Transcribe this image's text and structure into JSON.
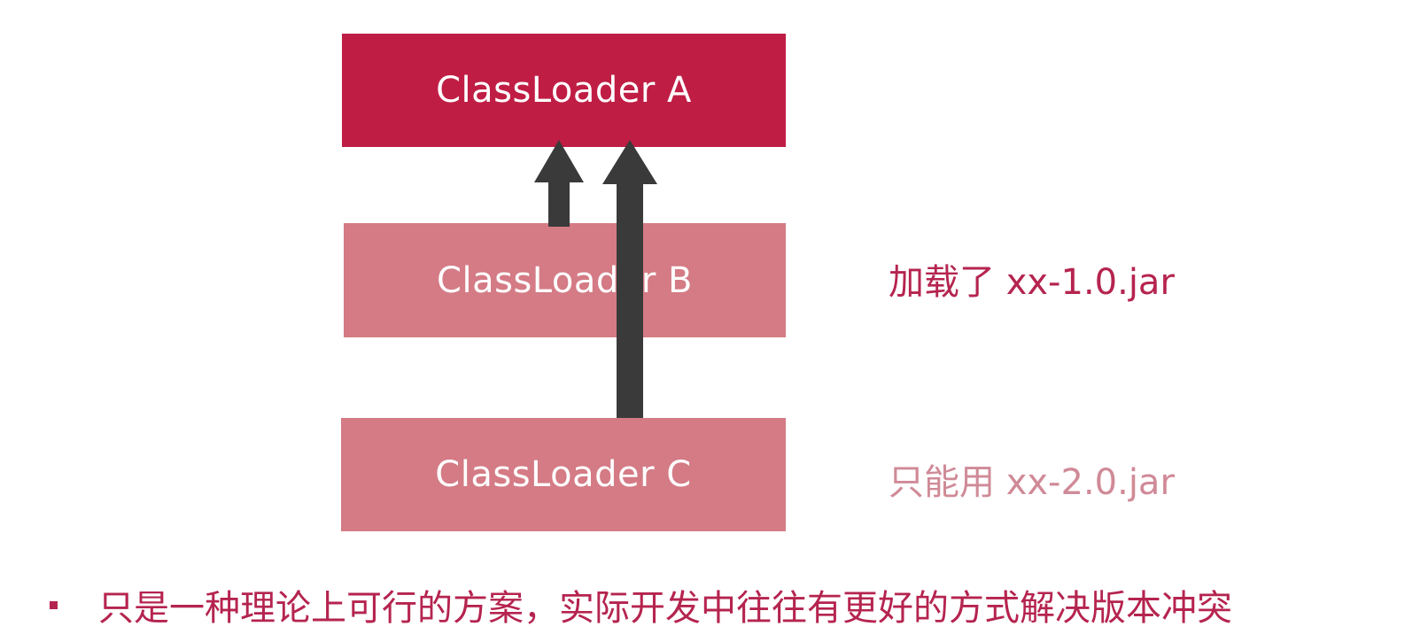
{
  "colors": {
    "primary": "#c01d45",
    "secondary": "#d47b85",
    "arrow": "#3a3a3a",
    "label_b": "#b5244f",
    "label_c": "#d08a97",
    "bullet": "#b5244f"
  },
  "boxes": {
    "a": {
      "label": "ClassLoader A"
    },
    "b": {
      "label": "ClassLoader B"
    },
    "c": {
      "label": "ClassLoader C"
    }
  },
  "annotations": {
    "b": "加载了 xx-1.0.jar",
    "c": "只能用 xx-2.0.jar"
  },
  "bullet": {
    "text": "只是一种理论上可行的方案，实际开发中往往有更好的方式解决版本冲突"
  }
}
